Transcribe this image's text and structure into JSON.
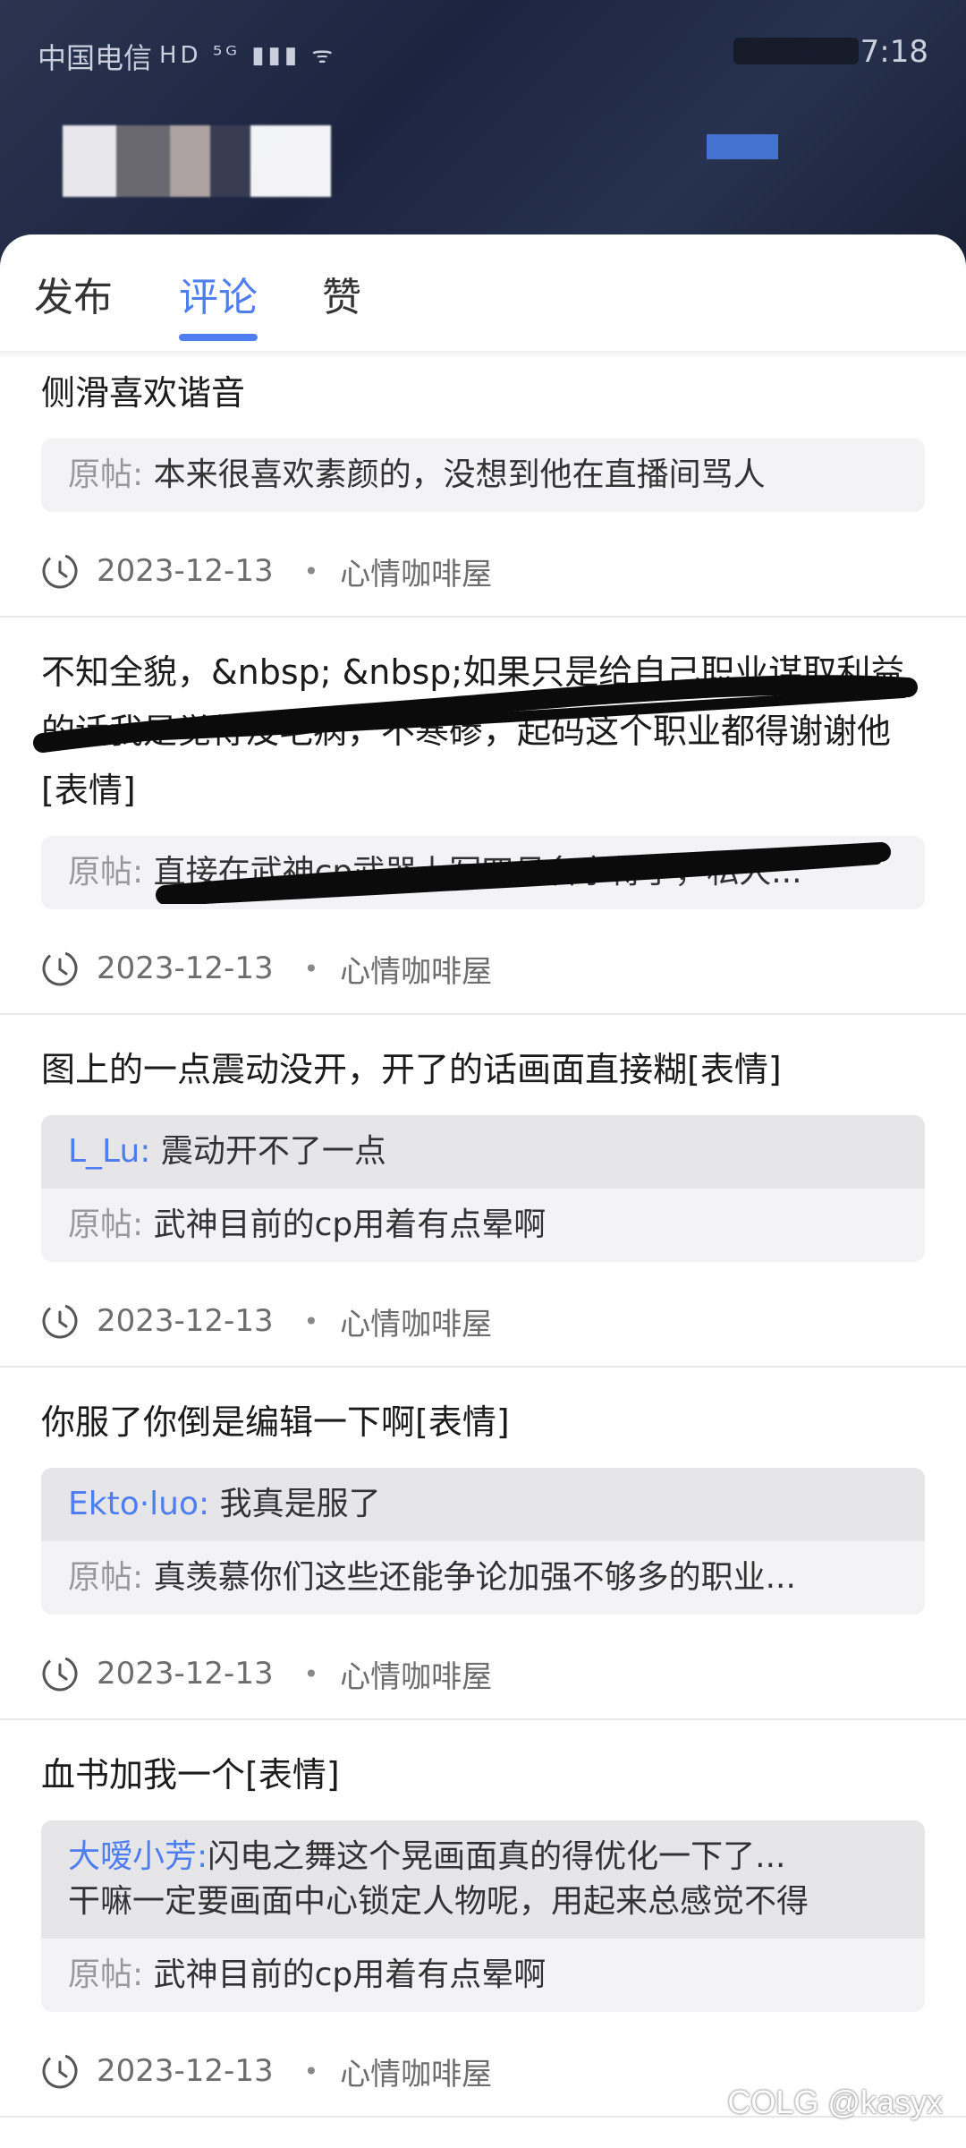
{
  "status_bar": {
    "carrier": "中国电信",
    "icons": "HD ⁵ᴳ ▮▮▮ ᯤ",
    "time": "7:18"
  },
  "tabs": [
    {
      "label": "发布"
    },
    {
      "label": "评论"
    },
    {
      "label": "赞"
    }
  ],
  "quote_prefix": "原帖:",
  "cards": [
    {
      "comment": "侧滑喜欢谐音",
      "original": "本来很喜欢素颜的，没想到他在直播间骂人",
      "date": "2023-12-13",
      "forum": "心情咖啡屋"
    },
    {
      "comment": "不知全貌，&nbsp; &nbsp;如果只是给自己职业谋取利益的话我是觉得没毛病，不寒碜，起码这个职业都得谢谢他[表情]",
      "original": "直接在武神cp武器上写四月名字得了，私人...",
      "date": "2023-12-13",
      "forum": "心情咖啡屋"
    },
    {
      "comment": "图上的一点震动没开，开了的话画面直接糊[表情]",
      "reply_user": "L_Lu:",
      "reply_text": "震动开不了一点",
      "original": "武神目前的cp用着有点晕啊",
      "date": "2023-12-13",
      "forum": "心情咖啡屋"
    },
    {
      "comment": "你服了你倒是编辑一下啊[表情]",
      "reply_user": "Ekto·luo:",
      "reply_text": "我真是服了",
      "original": "真羡慕你们这些还能争论加强不够多的职业...",
      "date": "2023-12-13",
      "forum": "心情咖啡屋"
    },
    {
      "comment": "血书加我一个[表情]",
      "reply_user": "大嗳小芳:",
      "reply_text": "闪电之舞这个晃画面真的得优化一下了...",
      "reply_text_2": "干嘛一定要画面中心锁定人物呢，用起来总感觉不得",
      "original": "武神目前的cp用着有点晕啊",
      "date": "2023-12-13",
      "forum": "心情咖啡屋"
    }
  ],
  "watermark": "COLG @kasyx",
  "colors": {
    "accent": "#4f7ef0",
    "header_bg": "#1c2440",
    "quote_bg": "#f3f3f5",
    "reply_bg": "#e6e6e9"
  }
}
